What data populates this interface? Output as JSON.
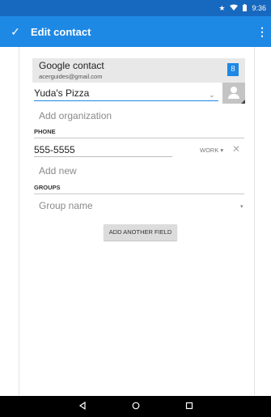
{
  "status_bar": {
    "icons": [
      "star-icon",
      "wifi-icon",
      "battery-icon"
    ],
    "time": "9:36"
  },
  "app_bar": {
    "title": "Edit contact",
    "confirm_icon": "check-icon",
    "overflow_icon": "more-vert-icon"
  },
  "account": {
    "name": "Google contact",
    "email": "acerguides@gmail.com",
    "icon": "google-icon",
    "icon_glyph": "8"
  },
  "name": {
    "value": "Yuda's Pizza"
  },
  "organization": {
    "placeholder": "Add organization"
  },
  "phone_section": {
    "header": "PHONE",
    "number": "555-5555",
    "type": "WORK",
    "add_new": "Add new"
  },
  "groups_section": {
    "header": "GROUPS",
    "placeholder": "Group name"
  },
  "add_field_button": "ADD ANOTHER FIELD",
  "colors": {
    "status_bar": "#1769bf",
    "app_bar": "#1e88e5",
    "accent": "#1e88e5"
  }
}
